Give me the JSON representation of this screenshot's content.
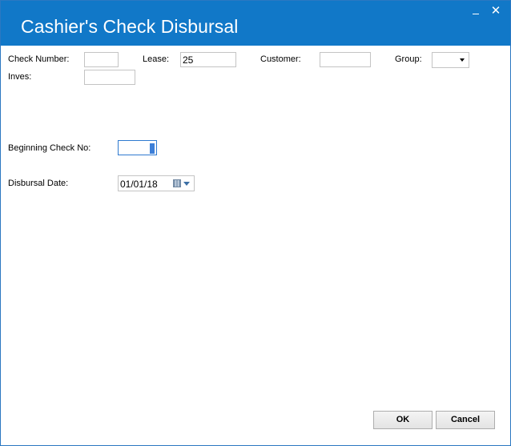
{
  "window": {
    "title": "Cashier's Check Disbursal",
    "close_glyph": "✕"
  },
  "form": {
    "check_number_label": "Check Number:",
    "check_number_value": "",
    "lease_label": "Lease:",
    "lease_value": "25",
    "customer_label": "Customer:",
    "customer_value": "",
    "group_label": "Group:",
    "group_value": "",
    "inves_label": "Inves:",
    "inves_value": "",
    "beginning_check_label": "Beginning Check No:",
    "beginning_check_value": "",
    "disbursal_date_label": "Disbursal Date:",
    "disbursal_date_value": "01/01/18"
  },
  "buttons": {
    "ok": "OK",
    "cancel": "Cancel"
  },
  "colors": {
    "titlebar": "#1178c8",
    "focus_border": "#2f7ad0"
  },
  "icons": {
    "minimize": "minimize-icon",
    "close": "close-icon",
    "calendar": "calendar-icon",
    "dropdown": "chevron-down-icon"
  }
}
